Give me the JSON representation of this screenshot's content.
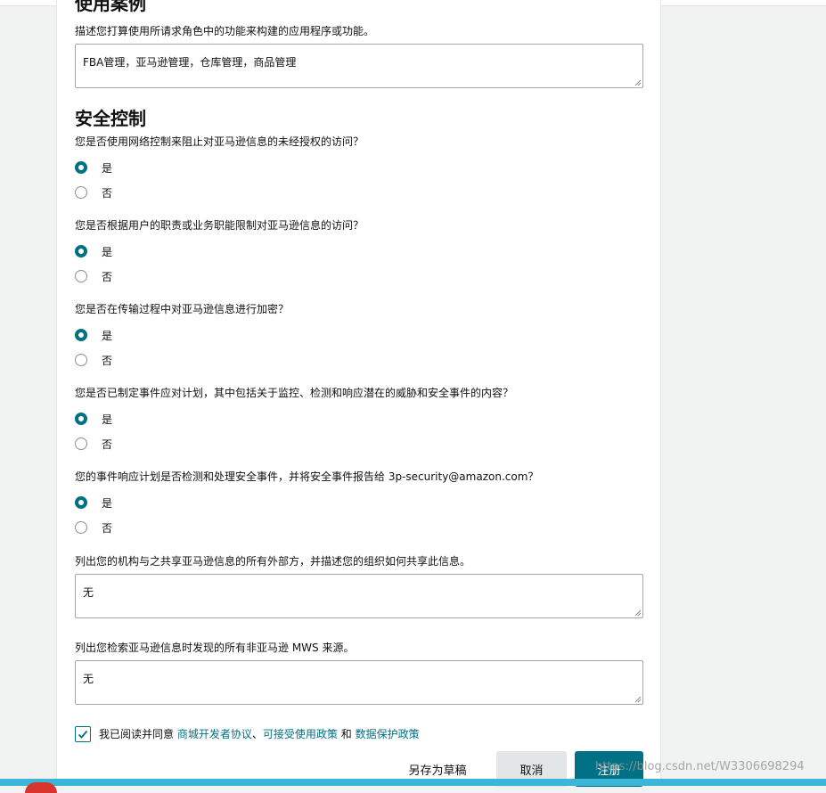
{
  "use_case": {
    "title": "使用案例",
    "description": "描述您打算使用所请求角色中的功能来构建的应用程序或功能。",
    "value": "FBA管理，亚马逊管理，仓库管理，商品管理"
  },
  "security": {
    "title": "安全控制",
    "questions": [
      {
        "text": "您是否使用网络控制来阻止对亚马逊信息的未经授权的访问？",
        "yes": "是",
        "no": "否",
        "selected": "yes"
      },
      {
        "text": "您是否根据用户的职责或业务职能限制对亚马逊信息的访问？",
        "yes": "是",
        "no": "否",
        "selected": "yes"
      },
      {
        "text": "您是否在传输过程中对亚马逊信息进行加密？",
        "yes": "是",
        "no": "否",
        "selected": "yes"
      },
      {
        "text": "您是否已制定事件应对计划，其中包括关于监控、检测和响应潜在的威胁和安全事件的内容？",
        "yes": "是",
        "no": "否",
        "selected": "yes"
      },
      {
        "text": "您的事件响应计划是否检测和处理安全事件，并将安全事件报告给 3p-security@amazon.com？",
        "yes": "是",
        "no": "否",
        "selected": "yes"
      }
    ]
  },
  "sharing": {
    "label": "列出您的机构与之共享亚马逊信息的所有外部方，并描述您的组织如何共享此信息。",
    "value": "无"
  },
  "sources": {
    "label": "列出您检索亚马逊信息时发现的所有非亚马逊 MWS 来源。",
    "value": "无"
  },
  "agreement": {
    "checked": true,
    "prefix": "我已阅读并同意",
    "link1": "商城开发者协议",
    "sep": "、",
    "link2": "可接受使用政策",
    "and": "和",
    "link3": "数据保护政策"
  },
  "buttons": {
    "draft": "另存为草稿",
    "cancel": "取消",
    "register": "注册"
  },
  "watermark": "https://blog.csdn.net/W3306698294",
  "colors": {
    "accent": "#007185",
    "cancel_bg": "#e3e6e6",
    "taskbar": "#3cb6d8"
  }
}
